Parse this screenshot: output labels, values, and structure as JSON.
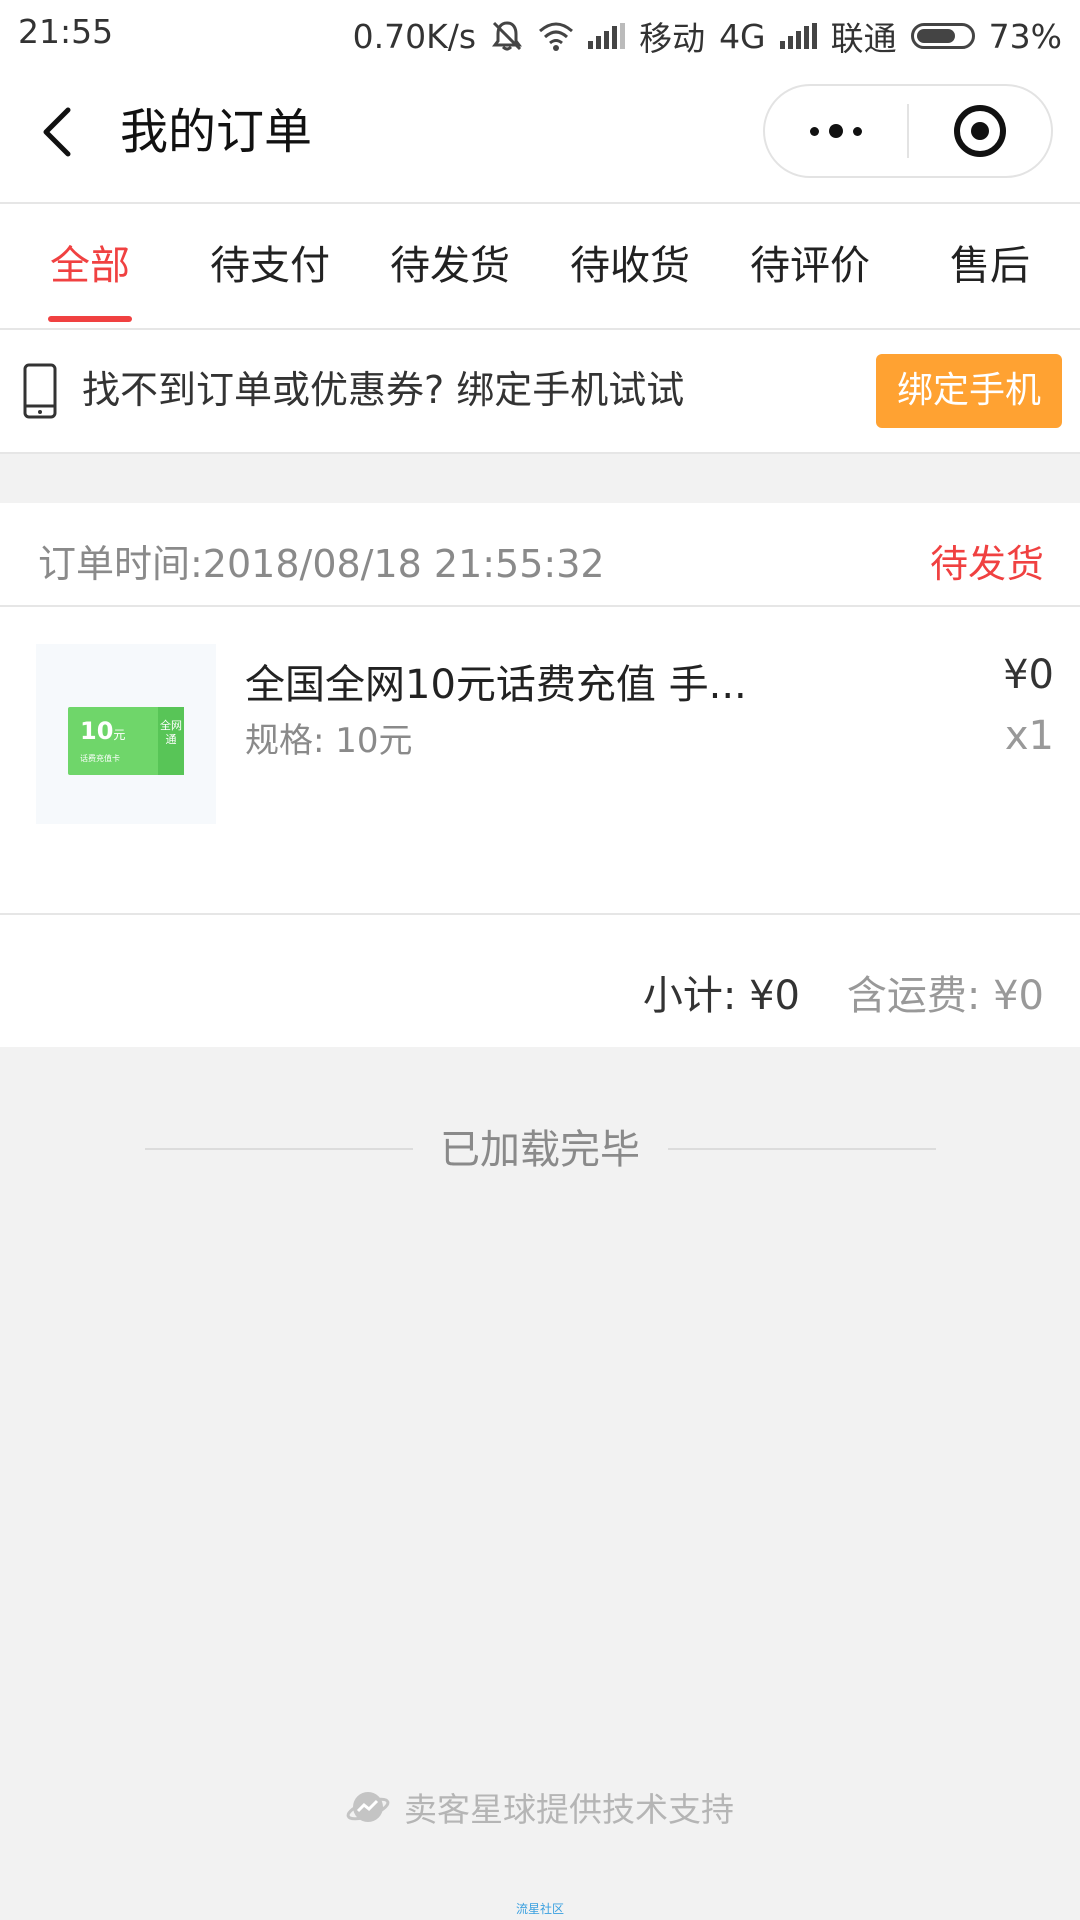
{
  "status_bar": {
    "time": "21:55",
    "network_speed": "0.70K/s",
    "carrier1": "移动",
    "network_type": "4G",
    "carrier2": "联通",
    "battery": "73%",
    "icons": [
      "mute-icon",
      "wifi-icon",
      "signal-icon",
      "battery-icon"
    ]
  },
  "header": {
    "title": "我的订单",
    "back_icon": "chevron-left-icon",
    "more_icon": "more-dots-icon",
    "close_icon": "target-icon"
  },
  "tabs": [
    {
      "label": "全部",
      "active": true
    },
    {
      "label": "待支付",
      "active": false
    },
    {
      "label": "待发货",
      "active": false
    },
    {
      "label": "待收货",
      "active": false
    },
    {
      "label": "待评价",
      "active": false
    },
    {
      "label": "售后",
      "active": false
    }
  ],
  "bind_banner": {
    "icon": "phone-icon",
    "text": "找不到订单或优惠券? 绑定手机试试",
    "button_label": "绑定手机"
  },
  "order": {
    "time_label": "订单时间:2018/08/18 21:55:32",
    "status": "待发货",
    "product": {
      "name": "全国全网10元话费充值 手...",
      "spec": "规格: 10元",
      "price": "¥0",
      "qty": "x1",
      "image": {
        "amount": "10",
        "unit": "元",
        "caption": "话费充值卡",
        "stub": "全网通"
      }
    },
    "subtotal": "小计: ¥0",
    "shipping": "含运费: ¥0"
  },
  "footer": {
    "loaded_text": "已加载完毕",
    "powered_by": "卖客星球提供技术支持",
    "powered_icon": "planet-icon",
    "watermark": "流星社区"
  },
  "colors": {
    "accent_red": "#f04141",
    "button_orange": "#ffa232",
    "background": "#f2f2f2"
  }
}
